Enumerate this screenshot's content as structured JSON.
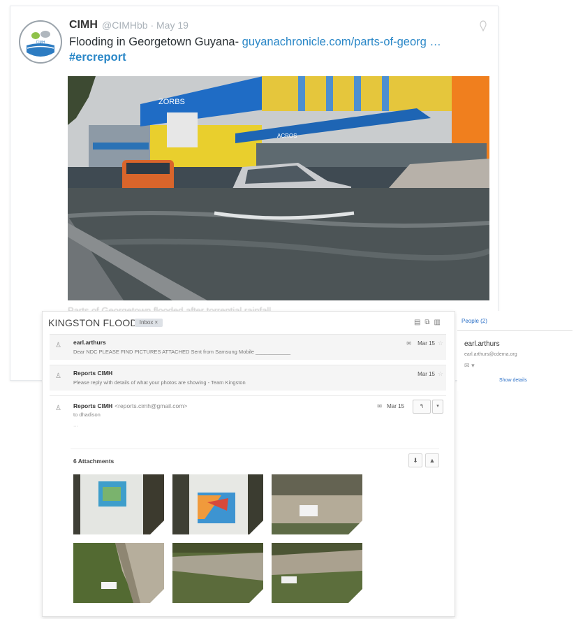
{
  "tweet": {
    "name": "CIMH",
    "handle": "@CIMHbb · May 19",
    "text_prefix": "Flooding in Georgetown Guyana- ",
    "link": "guyanachronicle.com/parts-of-georg …",
    "hashtag": "#ercreport",
    "caption": "Parts of Georgetown flooded after torrential rainfall",
    "avatar_logo_text": "CIMH",
    "photo_sign_1": "ZORBS",
    "photo_sign_2": "ACROS"
  },
  "gmail": {
    "subject": "KINGSTON FLOOD",
    "label": "Inbox ×",
    "messages": [
      {
        "from": "earl.arthurs",
        "snippet": "Dear NDC PLEASE FIND PICTURES ATTACHED Sent from Samsung Mobile ____________",
        "date": "Mar 15"
      },
      {
        "from": "Reports CIMH",
        "snippet": "Please reply with details of what your photos are showing - Team Kingston",
        "date": "Mar 15"
      }
    ],
    "open_message": {
      "from": "Reports CIMH",
      "email": "<reports.cimh@gmail.com>",
      "to": "to dhadison",
      "dots": "···",
      "date": "Mar 15",
      "attachments_header": "6 Attachments"
    }
  },
  "people": {
    "header": "People (2)",
    "name": "earl.arthurs",
    "email": "earl.arthurs@cdema.org",
    "show_details": "Show details"
  },
  "colors": {
    "link_blue": "#2a87c7",
    "gmail_link": "#2a6fc7",
    "row_bg": "#f5f5f5"
  }
}
